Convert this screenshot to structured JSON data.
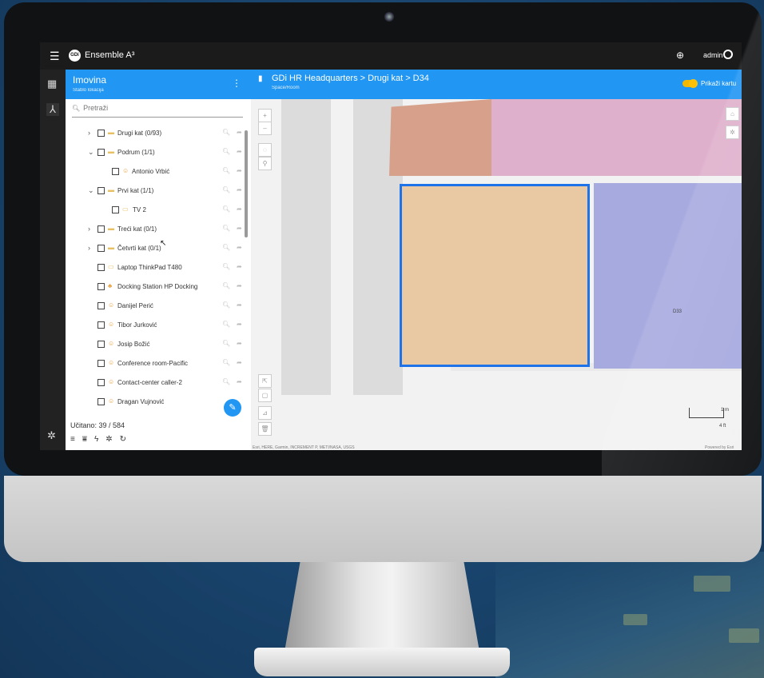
{
  "app": {
    "title": "Ensemble A³",
    "user": "admin",
    "logo_text": "GDi"
  },
  "panel": {
    "title": "Imovina",
    "subtitle": "Stablo lokacija",
    "search_placeholder": "Pretraži",
    "rows": [
      {
        "label": "Drugi kat (0/93)",
        "expander": "chevron-right",
        "icon": "folder-icon"
      },
      {
        "label": "Podrum (1/1)",
        "expander": "chevron-down",
        "icon": "folder-icon"
      },
      {
        "label": "Antonio Vrbić",
        "expander": "",
        "icon": "person-icon"
      },
      {
        "label": "Prvi kat (1/1)",
        "expander": "chevron-down",
        "icon": "folder-icon"
      },
      {
        "label": "TV 2",
        "expander": "",
        "icon": "tv-icon"
      },
      {
        "label": "Treći kat (0/1)",
        "expander": "chevron-right",
        "icon": "folder-icon"
      },
      {
        "label": "Četvrti kat (0/1)",
        "expander": "chevron-right",
        "icon": "folder-icon"
      },
      {
        "label": "Laptop ThinkPad T480",
        "expander": "",
        "icon": "laptop-icon"
      },
      {
        "label": "Docking Station HP Docking",
        "expander": "",
        "icon": "device-icon"
      },
      {
        "label": "Danijel Perić",
        "expander": "",
        "icon": "person-icon"
      },
      {
        "label": "Tibor Jurković",
        "expander": "",
        "icon": "person-icon"
      },
      {
        "label": "Josip Božić",
        "expander": "",
        "icon": "person-icon"
      },
      {
        "label": "Conference room-Pacific",
        "expander": "",
        "icon": "room-icon"
      },
      {
        "label": "Contact-center caller-2",
        "expander": "",
        "icon": "person-icon"
      },
      {
        "label": "Dragan Vujnović",
        "expander": "",
        "icon": "person-icon"
      }
    ],
    "loaded": "Učitano: 39 / 584"
  },
  "map": {
    "title": "GDi HR Headquarters > Drugi kat > D34",
    "subtitle": "Space/Room",
    "toggle_label": "Prikaži kartu",
    "room_label": "D33",
    "scale_m": "1 m",
    "scale_ft": "4 ft",
    "attribution": "Esri, HERE, Garmin, INCREMENT P, METI/NASA, USGS",
    "powered": "Powered by Esri"
  },
  "colors": {
    "accent": "#2196f3",
    "selected_room": "#e8c9a4",
    "room_pink": "#dfb0cc",
    "room_salmon": "#d6a08a",
    "room_blue": "#a7aadf",
    "toggle": "#ffc107"
  }
}
